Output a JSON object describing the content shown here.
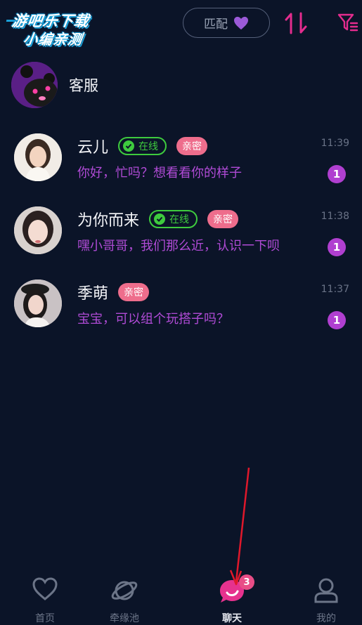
{
  "watermark": {
    "line1": "游吧乐下载",
    "line2": "小编亲测"
  },
  "header": {
    "match_label": "匹配",
    "match_icon": "heart-icon",
    "sort_icon": "sort-arrows-icon",
    "filter_icon": "filter-icon",
    "accent": "#e42c8e"
  },
  "service": {
    "label": "客服",
    "avatar_icon": "bear-mascot"
  },
  "chats": [
    {
      "name": "云儿",
      "online_label": "在线",
      "intimate_label": "亲密",
      "message": "你好，忙吗？想看看你的样子",
      "time": "11:39",
      "unread": "1"
    },
    {
      "name": "为你而来",
      "online_label": "在线",
      "intimate_label": "亲密",
      "message": "嘿小哥哥，我们那么近，认识一下呗",
      "time": "11:38",
      "unread": "1"
    },
    {
      "name": "季萌",
      "intimate_label": "亲密",
      "message": "宝宝，可以组个玩搭子吗？",
      "time": "11:37",
      "unread": "1"
    }
  ],
  "tabs": [
    {
      "label": "首页",
      "icon": "heart-outline-icon"
    },
    {
      "label": "牵缘池",
      "icon": "planet-icon"
    },
    {
      "label": "聊天",
      "icon": "chat-bubble-icon",
      "badge": "3",
      "active": true
    },
    {
      "label": "我的",
      "icon": "person-icon"
    }
  ],
  "colors": {
    "background": "#0b1428",
    "online": "#3ecb3e",
    "intimate": "#ee6d8c",
    "message": "#b04bd6",
    "unread": "#b03fd0"
  }
}
